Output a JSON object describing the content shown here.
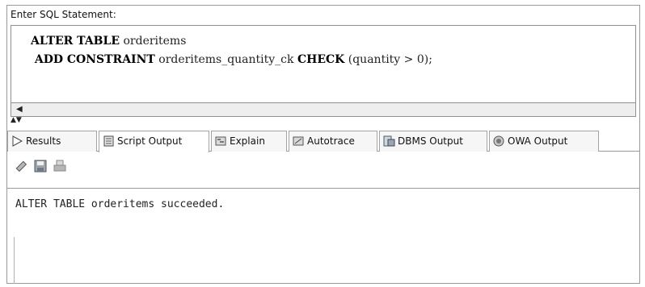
{
  "editor": {
    "header": "Enter SQL Statement:",
    "lines": [
      [
        {
          "text": "ALTER TABLE",
          "kw": true
        },
        {
          "text": " orderitems",
          "kw": false
        }
      ],
      [
        {
          "text": " ADD CONSTRAINT",
          "kw": true
        },
        {
          "text": " orderitems_quantity_ck ",
          "kw": false
        },
        {
          "text": "CHECK",
          "kw": true
        },
        {
          "text": " (quantity > 0);",
          "kw": false
        }
      ]
    ]
  },
  "tabs": [
    {
      "label": "Results",
      "icon": "play-icon"
    },
    {
      "label": "Script Output",
      "icon": "document-icon"
    },
    {
      "label": "Explain",
      "icon": "explain-icon"
    },
    {
      "label": "Autotrace",
      "icon": "autotrace-icon"
    },
    {
      "label": "DBMS Output",
      "icon": "dbms-output-icon"
    },
    {
      "label": "OWA Output",
      "icon": "owa-output-icon"
    }
  ],
  "active_tab": "Script Output",
  "toolbar": {
    "icons": [
      "eraser-icon",
      "save-icon",
      "print-icon"
    ]
  },
  "output": {
    "text": "ALTER TABLE orderitems succeeded."
  }
}
